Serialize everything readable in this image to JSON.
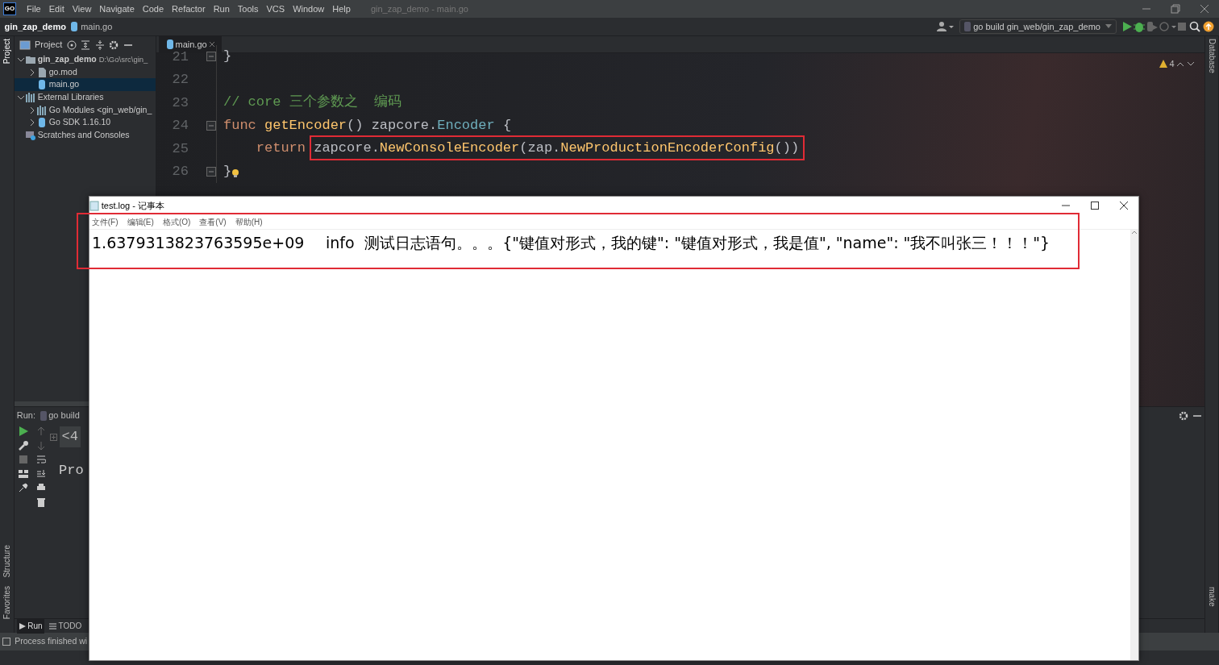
{
  "ide": {
    "logo": "GO",
    "menu": [
      "File",
      "Edit",
      "View",
      "Navigate",
      "Code",
      "Refactor",
      "Run",
      "Tools",
      "VCS",
      "Window",
      "Help"
    ],
    "title": "gin_zap_demo - main.go",
    "breadcrumb": [
      "gin_zap_demo",
      "main.go"
    ],
    "run_config": "go build gin_web/gin_zap_demo",
    "left_stripe": [
      "Project",
      "Structure",
      "Favorites"
    ],
    "right_stripe": [
      "Database",
      "make"
    ],
    "project_panel": {
      "title": "Project",
      "tree": [
        {
          "label": "gin_zap_demo",
          "path": "D:\\Go\\src\\gin_",
          "kind": "folder",
          "expanded": true,
          "selected": false,
          "children": [
            {
              "label": "go.mod",
              "kind": "file",
              "expanded": false,
              "selected": false
            },
            {
              "label": "main.go",
              "kind": "gofile",
              "selected": true
            }
          ]
        },
        {
          "label": "External Libraries",
          "kind": "library",
          "expanded": true,
          "selected": false,
          "children": [
            {
              "label": "Go Modules <gin_web/gin_",
              "kind": "library",
              "expanded": false,
              "selected": false
            },
            {
              "label": "Go SDK 1.16.10",
              "kind": "gofile",
              "expanded": false,
              "selected": false
            }
          ]
        },
        {
          "label": "Scratches and Consoles",
          "kind": "scratch",
          "selected": false
        }
      ]
    },
    "editor": {
      "tab": "main.go",
      "warnings": "4",
      "lines": [
        {
          "number": "21",
          "fold": true,
          "tokens": [
            {
              "text": "}",
              "kind": "plain"
            }
          ]
        },
        {
          "number": "22"
        },
        {
          "number": "23",
          "tokens": [
            {
              "text": "// core 三个参数之  编码",
              "kind": "comment"
            }
          ]
        },
        {
          "number": "24",
          "fold": true,
          "tokens": [
            {
              "text": "func ",
              "kind": "keyword"
            },
            {
              "text": "getEncoder",
              "kind": "func"
            },
            {
              "text": "() zapcore.",
              "kind": "plain"
            },
            {
              "text": "Encoder",
              "kind": "type"
            },
            {
              "text": " {",
              "kind": "plain"
            }
          ]
        },
        {
          "number": "25",
          "tokens": [
            {
              "text": "    return ",
              "kind": "keyword"
            },
            {
              "kind": "group",
              "highlighted": true,
              "children": [
                {
                  "text": "zapcore.",
                  "kind": "plain"
                },
                {
                  "text": "NewConsoleEncoder",
                  "kind": "func"
                },
                {
                  "text": "(zap.",
                  "kind": "plain"
                },
                {
                  "text": "NewProductionEncoderConfig",
                  "kind": "func"
                },
                {
                  "text": "())",
                  "kind": "plain"
                }
              ]
            }
          ]
        },
        {
          "number": "26",
          "fold": true,
          "bulb": true,
          "tokens": [
            {
              "text": "}",
              "kind": "plain"
            }
          ]
        }
      ]
    },
    "run_panel": {
      "label": "Run:",
      "tab": "go build",
      "fold_text": "<4",
      "output": "Pro"
    },
    "bottom_tabs": [
      {
        "label": "Run",
        "selected": true
      },
      {
        "label": "TODO",
        "selected": false
      }
    ],
    "status": "Process finished wi"
  },
  "notepad": {
    "title": "test.log - 记事本",
    "menu": [
      "文件(F)",
      "编辑(E)",
      "格式(O)",
      "查看(V)",
      "帮助(H)"
    ],
    "lines": [
      {
        "text": "1.6379313823763595e+09\tinfo\t测试日志语句。。。{\"键值对形式，我的键\": \"键值对形式，我是值\", \"name\": \"我不叫张三！！！\"}",
        "highlighted": true
      }
    ]
  }
}
